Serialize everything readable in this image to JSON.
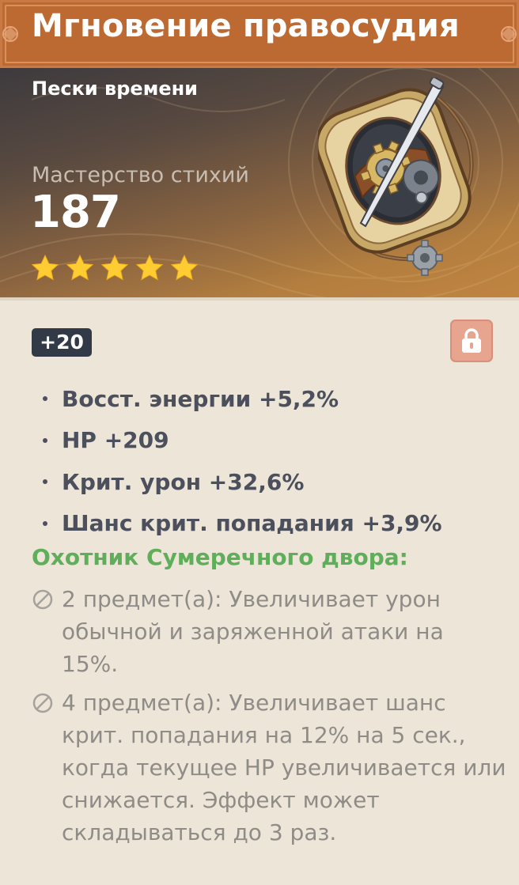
{
  "title": "Мгновение правосудия",
  "slot": "Пески времени",
  "main_stat": {
    "name": "Мастерство стихий",
    "value": "187"
  },
  "rarity": 5,
  "level": "+20",
  "locked": true,
  "substats": [
    "Восст. энергии +5,2%",
    "HP +209",
    "Крит. урон +32,6%",
    "Шанс крит. попадания +3,9%"
  ],
  "set": {
    "name": "Охотник Сумеречного двора:",
    "effects": [
      {
        "text": "2 предмет(а): Увеличивает урон обычной и заряженной атаки на 15%."
      },
      {
        "text": "4 предмет(а): Увеличивает шанс крит. попадания на 12% на 5 сек., когда текущее HP увеличивается или снижается. Эффект может складываться до 3 раз."
      }
    ]
  },
  "colors": {
    "title_bar": "#bd6932",
    "set_name": "#5eae5a",
    "star": "#ffcc32",
    "lock_bg": "#e7a48f",
    "badge_bg": "#333a47",
    "body_bg": "#ece5d8"
  },
  "icons": {
    "lock": "lock-icon",
    "star": "star-icon",
    "inactive_effect": "inactive-effect-icon",
    "artifact": "sands-of-time-artifact-image"
  }
}
